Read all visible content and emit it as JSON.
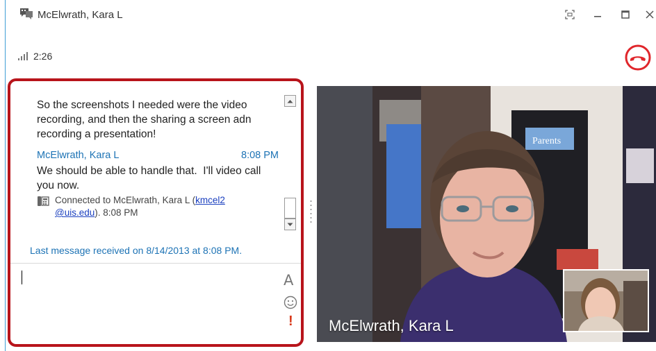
{
  "window": {
    "title": "McElwrath, Kara L",
    "icons": {
      "conversation": "conversation-icon",
      "fullscreen": "fullscreen-icon",
      "minimize": "minimize-icon",
      "maximize": "maximize-icon",
      "close": "close-icon"
    }
  },
  "call": {
    "elapsed": "2:26",
    "signal_icon": "signal-strength-icon",
    "hangup_icon": "hang-up-icon",
    "hangup_color": "#e0262b"
  },
  "chat": {
    "messages": [
      {
        "text": "So the screenshots I needed were the video recording, and then the sharing a screen adn recording a presentation!"
      },
      {
        "sender": "McElwrath, Kara L",
        "time": "8:08 PM",
        "text": "We should be able to handle that.  I'll video call you now."
      }
    ],
    "status": {
      "prefix": "Connected to McElwrath, Kara L (",
      "email_part1": "kmcel2",
      "email_part2": "@uis.edu",
      "suffix": "). 8:08 PM",
      "icon": "phone-icon"
    },
    "last_message": "Last message received on 8/14/2013 at 8:08 PM.",
    "compose": {
      "value": "",
      "font_label": "A",
      "emoticon_icon": "emoticon-icon",
      "importance_label": "!"
    },
    "highlight_color": "#b8141b",
    "link_color": "#1d73b5"
  },
  "video": {
    "participant_name": "McElwrath, Kara L",
    "poster_text": "Parents"
  }
}
